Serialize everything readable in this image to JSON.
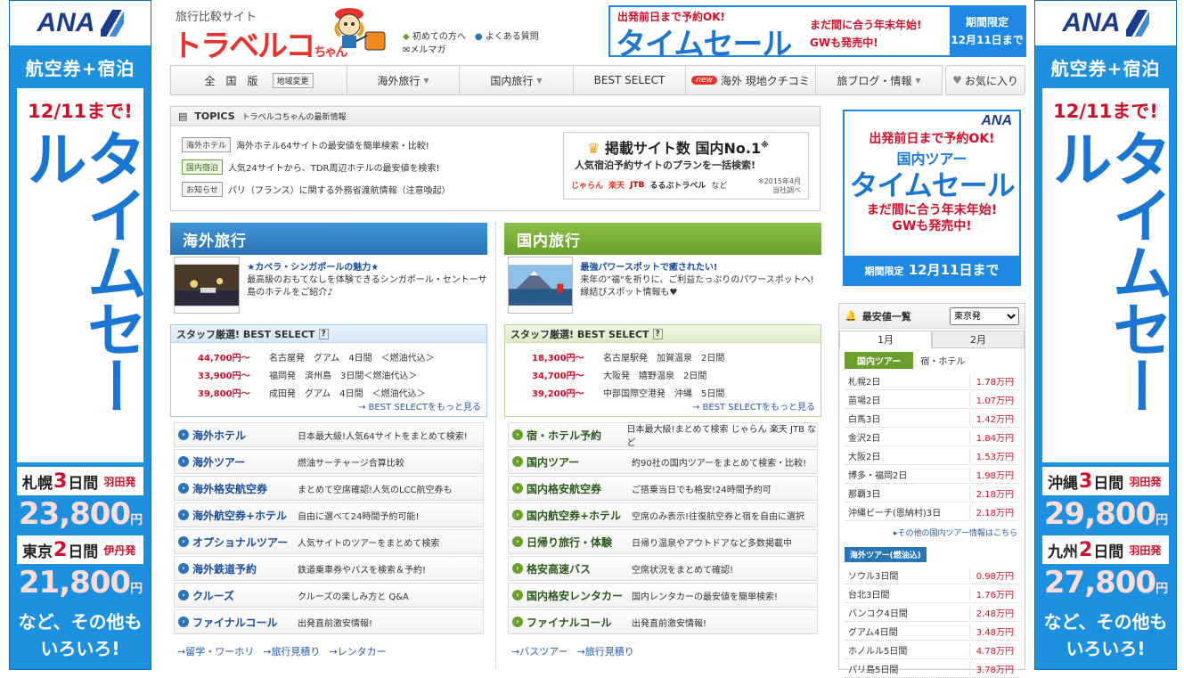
{
  "left_banner": {
    "logo": "ANA",
    "subtitle": "航空券+宿泊",
    "until": "12/11まで!",
    "vertical": "タイムセール",
    "deals": [
      {
        "city": "札幌",
        "days": "3",
        "unit": "日間",
        "dep": "羽田発",
        "price": "23,800",
        "yen": "円"
      },
      {
        "city": "東京",
        "days": "2",
        "unit": "日間",
        "dep": "伊丹発",
        "price": "21,800",
        "yen": "円"
      }
    ],
    "more1": "など、その他も",
    "more2": "いろいろ!"
  },
  "right_banner": {
    "logo": "ANA",
    "subtitle": "航空券+宿泊",
    "until": "12/11まで!",
    "vertical": "タイムセール",
    "deals": [
      {
        "city": "沖縄",
        "days": "3",
        "unit": "日間",
        "dep": "羽田発",
        "price": "29,800",
        "yen": "円"
      },
      {
        "city": "九州",
        "days": "2",
        "unit": "日間",
        "dep": "羽田発",
        "price": "27,800",
        "yen": "円"
      }
    ],
    "more1": "など、その他も",
    "more2": "いろいろ!"
  },
  "header": {
    "tagline": "旅行比較サイト",
    "brand": "トラベルコ",
    "brand_suffix": "ちゃん",
    "links": {
      "first": "初めての方へ",
      "faq": "よくある質問",
      "magazine": "メルマガ"
    }
  },
  "top_banner": {
    "line1": "出発前日まで予約OK!",
    "title": "タイムセール",
    "line3a": "まだ間に合う年末年始!",
    "line3b": "GWも発売中!",
    "period1": "期間限定",
    "period2": "12月11日まで"
  },
  "nav": {
    "zenkoku": "全　国　版",
    "region_btn": "地域変更",
    "overseas": "海外旅行",
    "domestic": "国内旅行",
    "best": "BEST SELECT",
    "new": "new",
    "kuchikomi": "海外 現地クチコミ",
    "blog": "旅ブログ・情報",
    "favorite": "お気に入り"
  },
  "topics": {
    "title": "TOPICS",
    "subtitle": "トラベルコちゃんの最新情報",
    "items": [
      {
        "tag": "海外ホテル",
        "text": "海外ホテル64サイトの最安値を簡単検索・比較!"
      },
      {
        "tag": "国内宿泊",
        "text": "人気24サイトから、TDR周辺ホテルの最安値を検索!"
      },
      {
        "tag": "お知らせ",
        "text": "パリ（フランス）に関する外務省渡航情報（注意喚起）"
      }
    ],
    "no1": {
      "title": "掲載サイト数 国内No.1",
      "mark": "※",
      "sub": "人気宿泊予約サイトのプランを一括検索!",
      "logos": [
        "じゃらん",
        "楽天",
        "JTB",
        "るるぶトラベル"
      ],
      "nado": "など",
      "note1": "※2015年4月",
      "note2": "当社調べ"
    }
  },
  "overseas": {
    "header": "海外旅行",
    "feature": {
      "title": "★カペラ・シンガポールの魅力★",
      "body": "最高級のおもてなしを体験できるシンガポール・セントーサ島のホテルをご紹介♪"
    },
    "best_title": "スタッフ厳選! BEST SELECT",
    "best": [
      {
        "price": "44,700円〜",
        "text": "名古屋発　グアム　4日間　＜燃油代込＞"
      },
      {
        "price": "33,900円〜",
        "text": "福岡発　済州島　3日間＜燃油代込＞"
      },
      {
        "price": "39,800円〜",
        "text": "成田発　グアム　4日間　＜燃油代込＞"
      }
    ],
    "best_more": "BEST SELECTをもっと見る",
    "services": [
      {
        "name": "海外ホテル",
        "desc": "日本最大級!人気64サイトをまとめて検索!"
      },
      {
        "name": "海外ツアー",
        "desc": "燃油サーチャージ合算比較"
      },
      {
        "name": "海外格安航空券",
        "desc": "まとめて空席確認!人気のLCC航空券も"
      },
      {
        "name": "海外航空券+ホテル",
        "desc": "自由に選べて24時間予約可能!"
      },
      {
        "name": "オプショナルツアー",
        "desc": "人気サイトのツアーをまとめて検索"
      },
      {
        "name": "海外鉄道予約",
        "desc": "鉄道乗車券やパスを検索＆予約!"
      },
      {
        "name": "クルーズ",
        "desc": "クルーズの楽しみ方と Q&A"
      },
      {
        "name": "ファイナルコール",
        "desc": "出発直前激安情報!"
      }
    ],
    "bottom": [
      "留学・ワーホリ",
      "旅行見積り",
      "レンタカー"
    ]
  },
  "domestic": {
    "header": "国内旅行",
    "feature": {
      "title": "最強パワースポットで癒されたい!",
      "body": "来年の\"福\"を祈りに、ご利益たっぷりのパワースポットへ!縁結びスポット情報も♥"
    },
    "best_title": "スタッフ厳選! BEST SELECT",
    "best": [
      {
        "price": "18,300円〜",
        "text": "名古屋駅発　加賀温泉　2日間"
      },
      {
        "price": "34,700円〜",
        "text": "大阪発　嬉野温泉　2日間"
      },
      {
        "price": "39,200円〜",
        "text": "中部国際空港発　沖縄　5日間"
      }
    ],
    "best_more": "BEST SELECTをもっと見る",
    "services": [
      {
        "name": "宿・ホテル予約",
        "desc": "日本最大級!まとめて検索 じゃらん 楽天 JTB など"
      },
      {
        "name": "国内ツアー",
        "desc": "約90社の国内ツアーをまとめて検索・比較!"
      },
      {
        "name": "国内格安航空券",
        "desc": "ご搭乗当日でも格安!24時間予約可"
      },
      {
        "name": "国内航空券+ホテル",
        "desc": "空席のみ表示!往復航空券と宿を自由に選択"
      },
      {
        "name": "日帰り旅行・体験",
        "desc": "日帰り温泉やアウトドアなど多数掲載中"
      },
      {
        "name": "格安高速バス",
        "desc": "空席状況をまとめて確認!"
      },
      {
        "name": "国内格安レンタカー",
        "desc": "国内レンタカーの最安値を簡単検索!"
      },
      {
        "name": "ファイナルコール",
        "desc": "出発直前激安情報!"
      }
    ],
    "bottom": [
      "バスツアー",
      "旅行見積り"
    ]
  },
  "right_ad": {
    "logo": "ANA",
    "l1": "出発前日まで予約OK!",
    "l2": "国内ツアー",
    "l3": "タイムセール",
    "l4": "まだ間に合う年末年始!",
    "l5": "GWも発売中!",
    "p1": "期間限定",
    "p2": "12月11日まで"
  },
  "cheapest": {
    "title": "最安値一覧",
    "origin": "東京発",
    "tabs": [
      "1月",
      "2月"
    ],
    "subtabs": [
      "国内ツアー",
      "宿・ホテル"
    ],
    "domestic": [
      {
        "n": "札幌2日",
        "v": "1.78万円"
      },
      {
        "n": "苗場2日",
        "v": "1.07万円"
      },
      {
        "n": "白馬3日",
        "v": "1.42万円"
      },
      {
        "n": "金沢2日",
        "v": "1.84万円"
      },
      {
        "n": "大阪2日",
        "v": "1.53万円"
      },
      {
        "n": "博多・福岡2日",
        "v": "1.98万円"
      },
      {
        "n": "那覇3日",
        "v": "2.18万円"
      },
      {
        "n": "沖縄ビーチ(恩納村)3日",
        "v": "2.18万円"
      }
    ],
    "more": "その他の国内ツアー情報はこちら",
    "overseas_title": "海外ツアー(燃油込)",
    "overseas": [
      {
        "n": "ソウル3日間",
        "v": "0.98万円"
      },
      {
        "n": "台北3日間",
        "v": "1.76万円"
      },
      {
        "n": "バンコク4日間",
        "v": "2.48万円"
      },
      {
        "n": "グアム4日間",
        "v": "3.48万円"
      },
      {
        "n": "ホノルル5日間",
        "v": "4.78万円"
      },
      {
        "n": "パリ島5日間",
        "v": "3.78万円"
      }
    ]
  }
}
